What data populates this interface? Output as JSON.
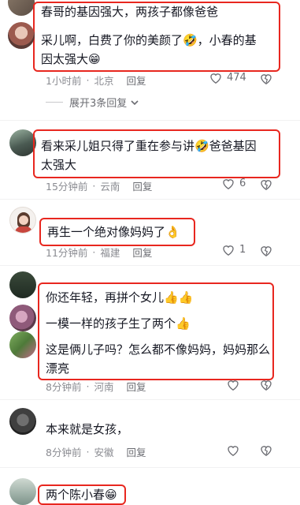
{
  "comments": [
    {
      "lines": [
        "春哥的基因强大，两孩子都像爸爸"
      ]
    },
    {
      "lines": [
        "采儿啊，白费了你的美颜了🤣，小春的基",
        "因太强大😁"
      ],
      "time": "1小时前",
      "location": "北京",
      "reply": "回复",
      "likes": "474"
    },
    {
      "lines": [
        "看来采儿姐只得了重在参与讲🤣爸爸基因",
        "太强大"
      ],
      "time": "15分钟前",
      "location": "云南",
      "reply": "回复",
      "likes": "6"
    },
    {
      "lines": [
        "再生一个绝对像妈妈了👌"
      ],
      "time": "11分钟前",
      "location": "福建",
      "reply": "回复",
      "likes": "1"
    },
    {
      "lines": [
        "你还年轻，再拼个女儿👍👍",
        "一模一样的孩子生了两个👍",
        "这是俩儿子吗？怎么都不像妈妈，妈妈那么",
        "漂亮"
      ],
      "time": "8分钟前",
      "location": "河南",
      "reply": "回复"
    },
    {
      "lines": [
        "本来就是女孩，"
      ],
      "time": "8分钟前",
      "location": "安徽",
      "reply": "回复"
    },
    {
      "lines": [
        "两个陈小春😁"
      ]
    }
  ],
  "expand_replies": "展开3条回复",
  "colors": {
    "highlight": "#e8271f",
    "meta": "#8a8b91",
    "text": "#161823"
  },
  "icons": {
    "like": "heart-outline-icon",
    "dislike": "broken-heart-icon",
    "expand": "chevron-down-icon"
  }
}
